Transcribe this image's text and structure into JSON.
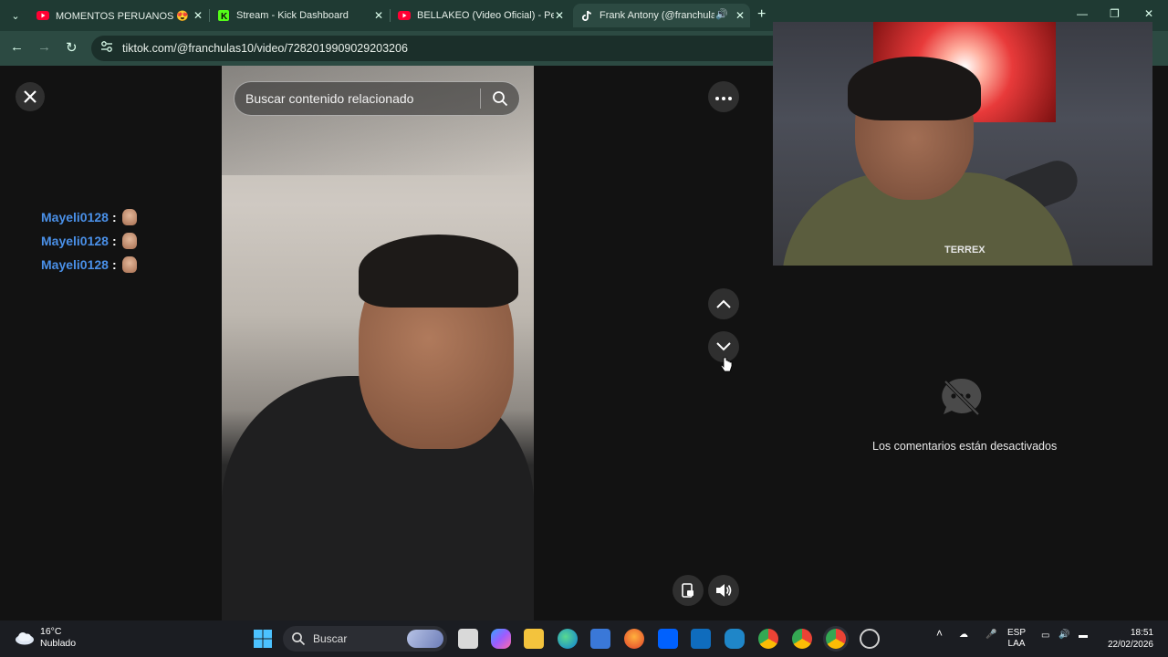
{
  "browser": {
    "tabs": [
      {
        "title": "MOMENTOS PERUANOS 😍 PE",
        "favicon": "youtube-icon",
        "active": false
      },
      {
        "title": "Stream - Kick Dashboard",
        "favicon": "kick-icon",
        "active": false
      },
      {
        "title": "BELLAKEO (Video Oficial) - Pes",
        "favicon": "youtube-icon",
        "active": false
      },
      {
        "title": "Frank Antony (@franchulas",
        "favicon": "tiktok-icon",
        "active": true
      }
    ],
    "url": "tiktok.com/@franchulas10/video/7282019909029203206"
  },
  "video_page": {
    "search_placeholder": "Buscar contenido relacionado",
    "comments_disabled": "Los comentarios están desactivados"
  },
  "chat": {
    "messages": [
      {
        "user": "Mayeli0128",
        "colon": ":"
      },
      {
        "user": "Mayeli0128",
        "colon": ":"
      },
      {
        "user": "Mayeli0128",
        "colon": ":"
      }
    ]
  },
  "webcam": {
    "shirt_text": "TERREX"
  },
  "taskbar": {
    "weather_temp": "16°C",
    "weather_desc": "Nublado",
    "search_label": "Buscar",
    "lang_top": "ESP",
    "lang_bottom": "LAA",
    "time": "18:51",
    "date": "22/02/2026"
  },
  "colors": {
    "chrome_frame": "#1f3a33",
    "chrome_toolbar": "#2c4a42",
    "chat_username": "#4a90e8",
    "page_background": "#121212"
  }
}
